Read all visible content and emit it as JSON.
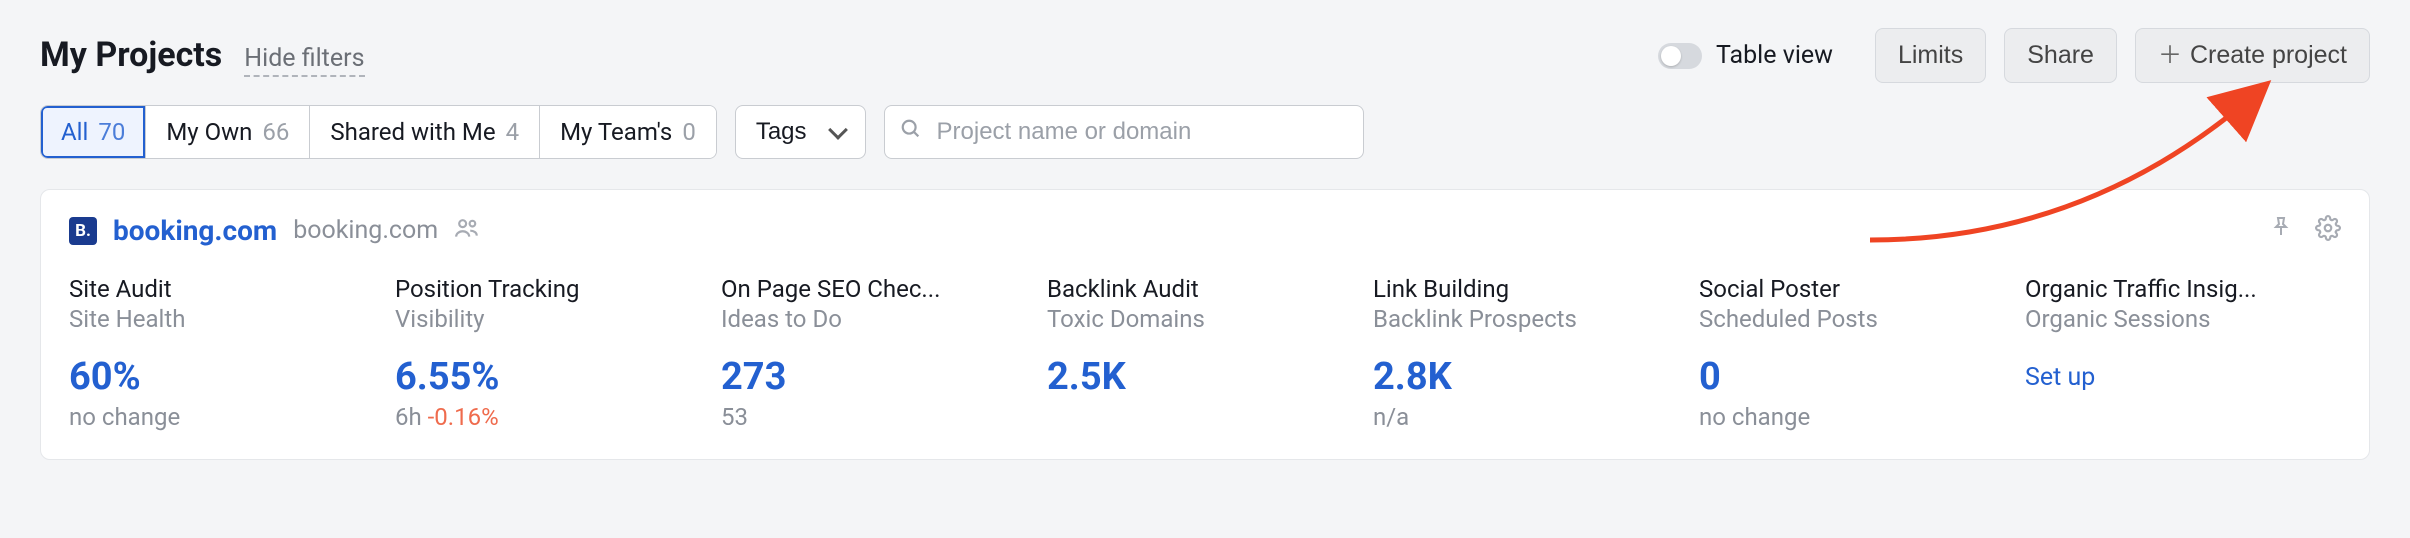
{
  "header": {
    "title": "My Projects",
    "hide_filters": "Hide filters",
    "table_view_label": "Table view",
    "limits_label": "Limits",
    "share_label": "Share",
    "create_label": "Create project"
  },
  "filters": {
    "tabs": [
      {
        "label": "All",
        "count": "70"
      },
      {
        "label": "My Own",
        "count": "66"
      },
      {
        "label": "Shared with Me",
        "count": "4"
      },
      {
        "label": "My Team's",
        "count": "0"
      }
    ],
    "tags_label": "Tags",
    "search_placeholder": "Project name or domain"
  },
  "project": {
    "favicon_letter": "B.",
    "name": "booking.com",
    "domain": "booking.com"
  },
  "metrics": [
    {
      "title": "Site Audit",
      "subtitle": "Site Health",
      "value": "60%",
      "change": "no change",
      "change_prefix": ""
    },
    {
      "title": "Position Tracking",
      "subtitle": "Visibility",
      "value": "6.55%",
      "change": "-0.16%",
      "change_prefix": "6h "
    },
    {
      "title": "On Page SEO Chec...",
      "subtitle": "Ideas to Do",
      "value": "273",
      "change": "53",
      "change_prefix": ""
    },
    {
      "title": "Backlink Audit",
      "subtitle": "Toxic Domains",
      "value": "2.5K",
      "change": "",
      "change_prefix": ""
    },
    {
      "title": "Link Building",
      "subtitle": "Backlink Prospects",
      "value": "2.8K",
      "change": "n/a",
      "change_prefix": ""
    },
    {
      "title": "Social Poster",
      "subtitle": "Scheduled Posts",
      "value": "0",
      "change": "no change",
      "change_prefix": ""
    },
    {
      "title": "Organic Traffic Insig...",
      "subtitle": "Organic Sessions",
      "value": "",
      "setup": "Set up"
    }
  ],
  "colors": {
    "accent": "#2360d0",
    "annotation": "#ef4423"
  }
}
